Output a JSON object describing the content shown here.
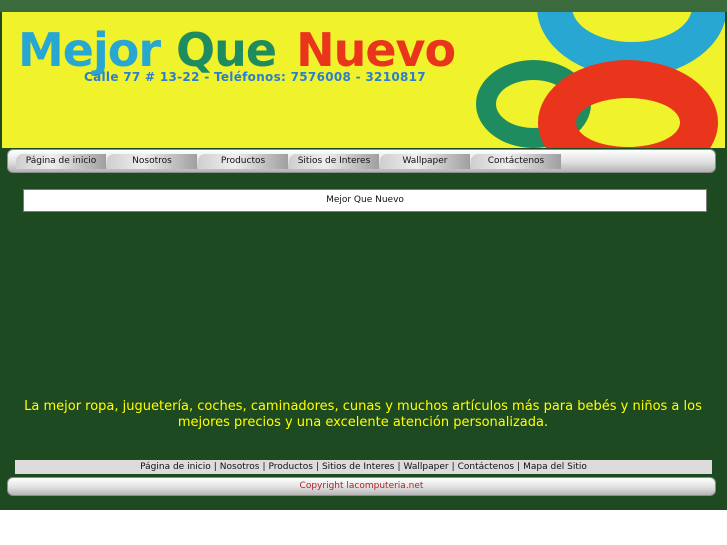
{
  "header": {
    "logo_word1": "Mejor",
    "logo_word2": "Que",
    "logo_word3": "Nuevo",
    "address": "Calle 77 # 13-22 - Teléfonos: 7576008 - 3210817"
  },
  "nav": {
    "items": [
      {
        "label": "Página de inicio"
      },
      {
        "label": "Nosotros"
      },
      {
        "label": "Productos"
      },
      {
        "label": "Sitios de Interes"
      },
      {
        "label": "Wallpaper"
      },
      {
        "label": "Contáctenos"
      }
    ]
  },
  "main": {
    "title": "Mejor Que Nuevo",
    "tagline": "La mejor ropa, juguetería, coches, caminadores, cunas y muchos artículos más para bebés y niños a los mejores precios y una excelente atención personalizada."
  },
  "footer": {
    "links": [
      {
        "label": "Página de inicio"
      },
      {
        "label": "Nosotros"
      },
      {
        "label": "Productos"
      },
      {
        "label": "Sitios de Interes"
      },
      {
        "label": "Wallpaper"
      },
      {
        "label": "Contáctenos"
      },
      {
        "label": "Mapa del Sitio"
      }
    ],
    "separator": "|",
    "copyright": "Copyright lacomputeria.net"
  },
  "colors": {
    "page_bg": "#1e4a22",
    "header_bg": "#f0f22c",
    "tagline": "#ffff00",
    "copyright": "#b22020"
  }
}
